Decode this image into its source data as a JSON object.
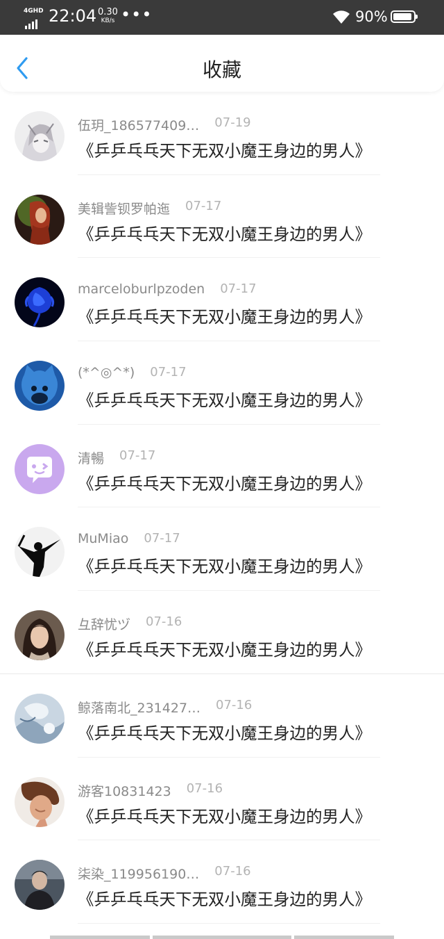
{
  "status_bar": {
    "network": "4GHD",
    "time": "22:04",
    "speed_value": "0.30",
    "speed_unit": "KB/s",
    "dots": "•••",
    "battery": "90%"
  },
  "header": {
    "title": "收藏",
    "back_icon": "chevron-left-icon"
  },
  "favorites": [
    {
      "username": "伍玥_186577409…",
      "date": "07-19",
      "book": "《乒乒乓乓天下无双小魔王身边的男人》"
    },
    {
      "username": "美辑訾钡罗帕迤",
      "date": "07-17",
      "book": "《乒乒乓乓天下无双小魔王身边的男人》"
    },
    {
      "username": "marceloburlpzoden",
      "date": "07-17",
      "book": "《乒乒乓乓天下无双小魔王身边的男人》"
    },
    {
      "username": "(*^◎^*)",
      "date": "07-17",
      "book": "《乒乒乓乓天下无双小魔王身边的男人》"
    },
    {
      "username": "清暢",
      "date": "07-17",
      "book": "《乒乒乓乓天下无双小魔王身边的男人》"
    },
    {
      "username": "MuMiao",
      "date": "07-17",
      "book": "《乒乒乓乓天下无双小魔王身边的男人》"
    },
    {
      "username": "彑辞忧ヅ",
      "date": "07-16",
      "book": "《乒乒乓乓天下无双小魔王身边的男人》"
    },
    {
      "username": "鲸落南北_231427…",
      "date": "07-16",
      "book": "《乒乒乓乓天下无双小魔王身边的男人》"
    },
    {
      "username": "游客10831423",
      "date": "07-16",
      "book": "《乒乒乓乓天下无双小魔王身边的男人》"
    },
    {
      "username": "柒染_119956190…",
      "date": "07-16",
      "book": "《乒乒乓乓天下无双小魔王身边的男人》"
    }
  ],
  "colors": {
    "accent": "#2f9bf0",
    "status_bar_bg": "#3a3a3a",
    "username": "#8a8a8a",
    "date": "#b3b3b3",
    "title_text": "#222222"
  }
}
